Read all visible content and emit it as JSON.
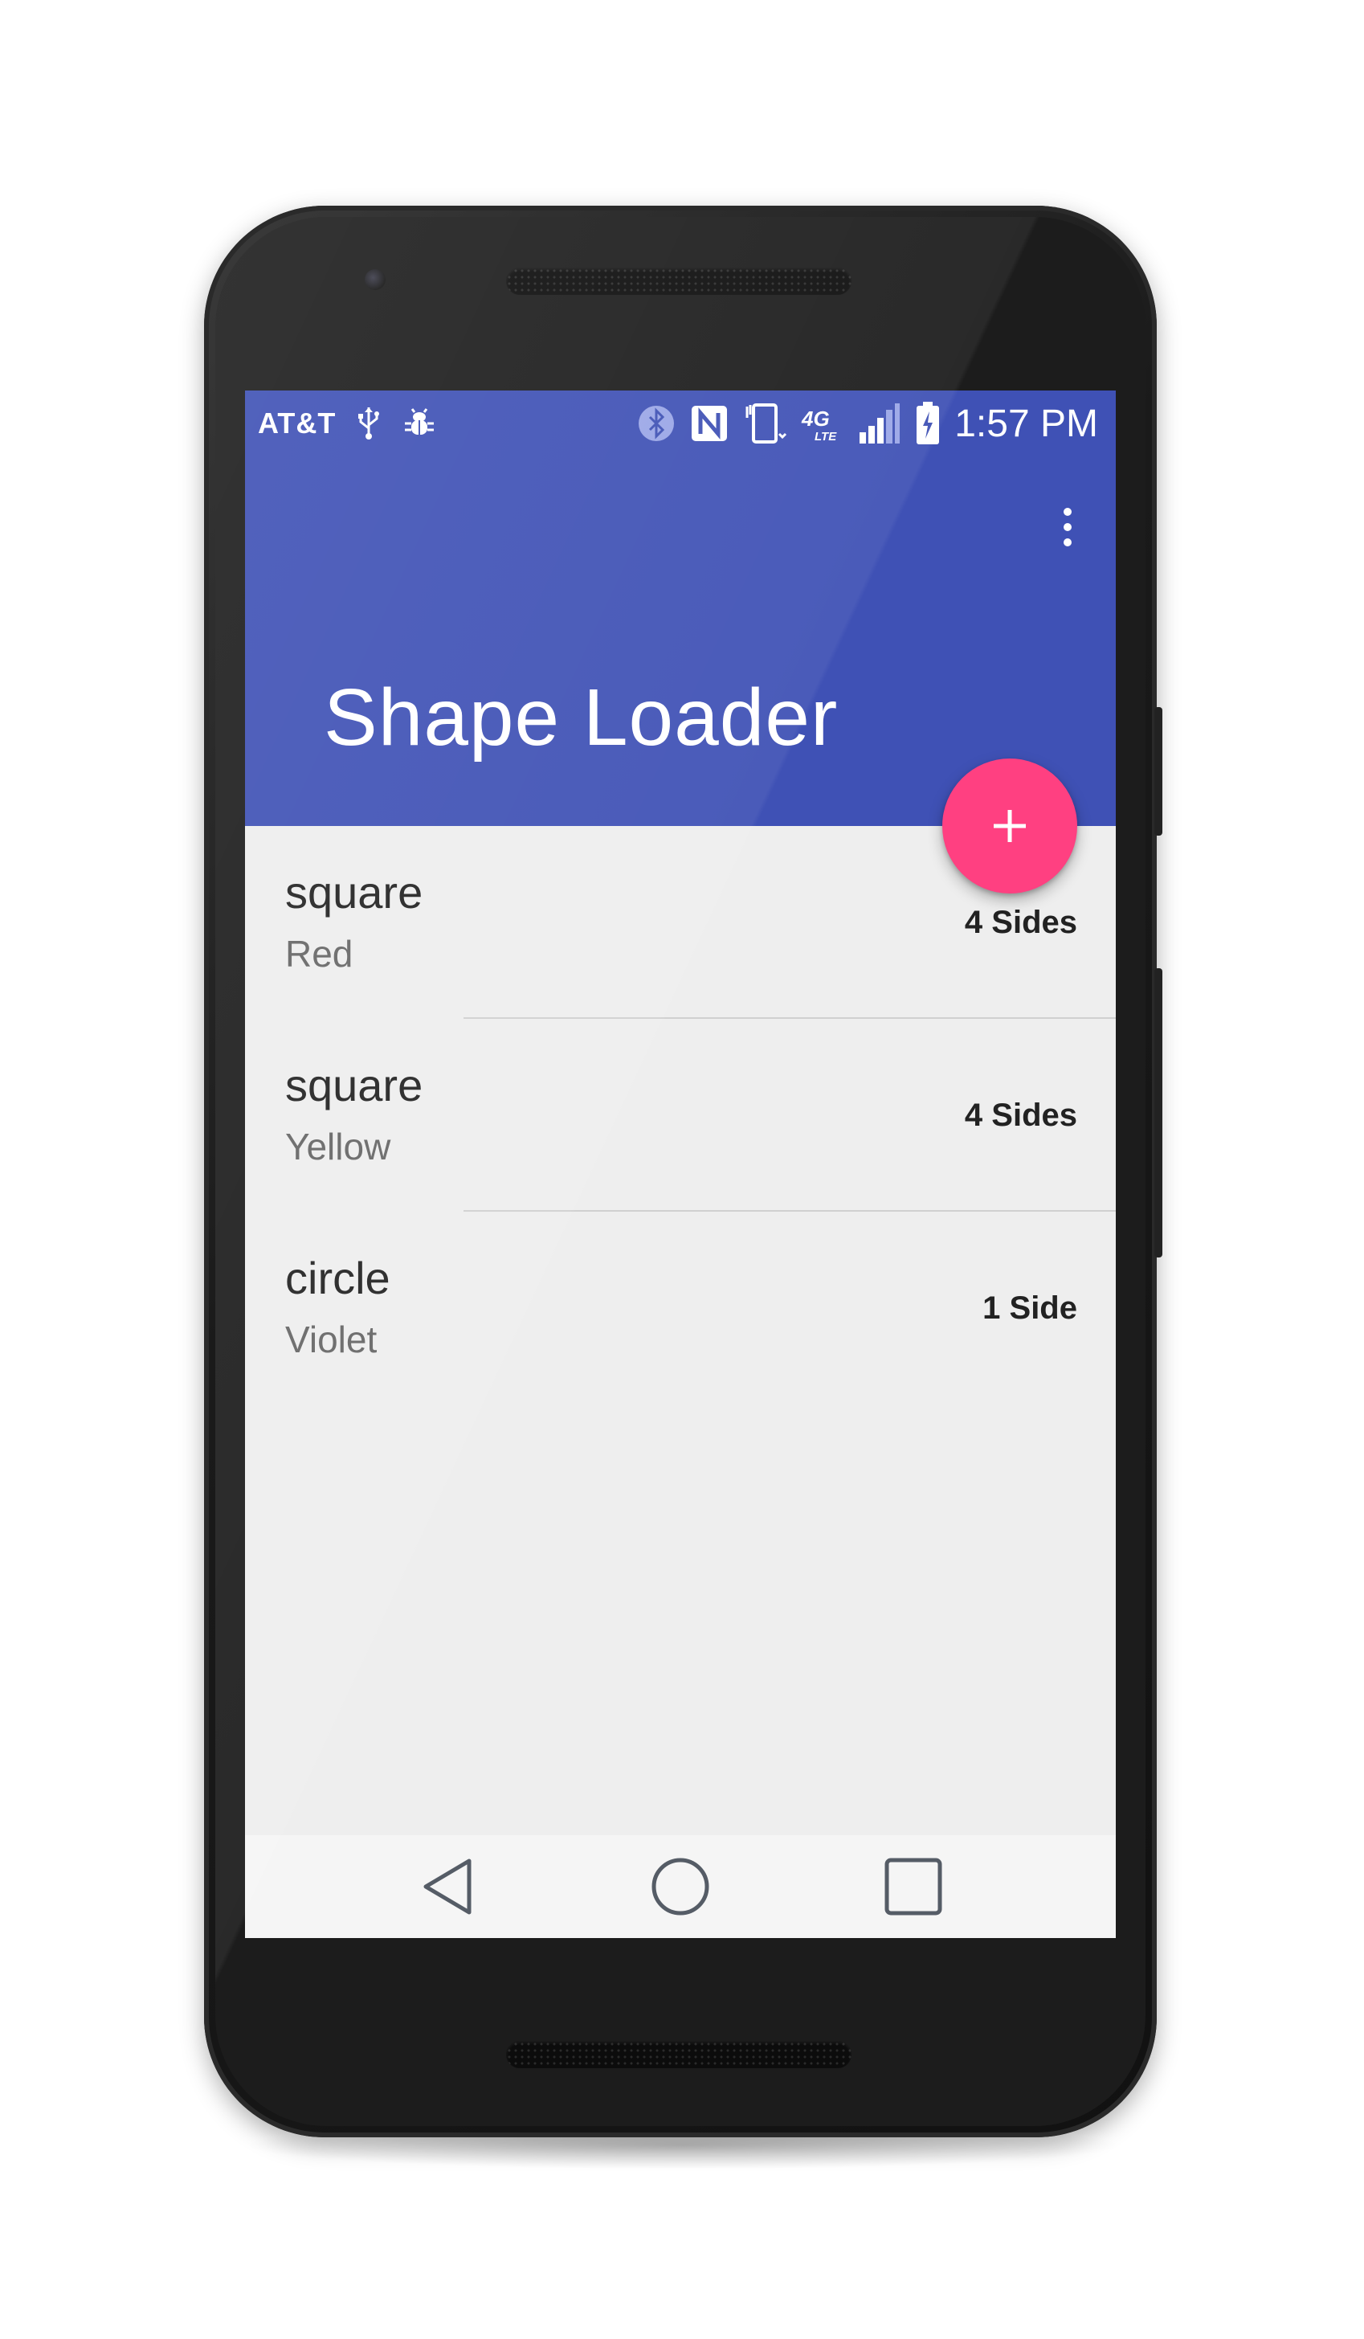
{
  "status_bar": {
    "carrier": "AT&T",
    "time": "1:57 PM",
    "network": "4G",
    "network_sub": "LTE",
    "icons": [
      "usb-icon",
      "debug-icon",
      "bluetooth-icon",
      "nfc-icon",
      "vibrate-icon",
      "network-4g-lte-icon",
      "signal-icon",
      "battery-charging-icon"
    ]
  },
  "app_bar": {
    "title": "Shape Loader",
    "menu_icon": "more-vert-icon",
    "color": "#3f51b5"
  },
  "fab": {
    "icon": "plus-icon",
    "color": "#ff4081"
  },
  "shapes": [
    {
      "name": "square",
      "color": "Red",
      "sides": "4 Sides"
    },
    {
      "name": "square",
      "color": "Yellow",
      "sides": "4 Sides"
    },
    {
      "name": "circle",
      "color": "Violet",
      "sides": "1 Side"
    }
  ],
  "nav_bar": {
    "buttons": [
      "back-icon",
      "home-icon",
      "recents-icon"
    ]
  }
}
